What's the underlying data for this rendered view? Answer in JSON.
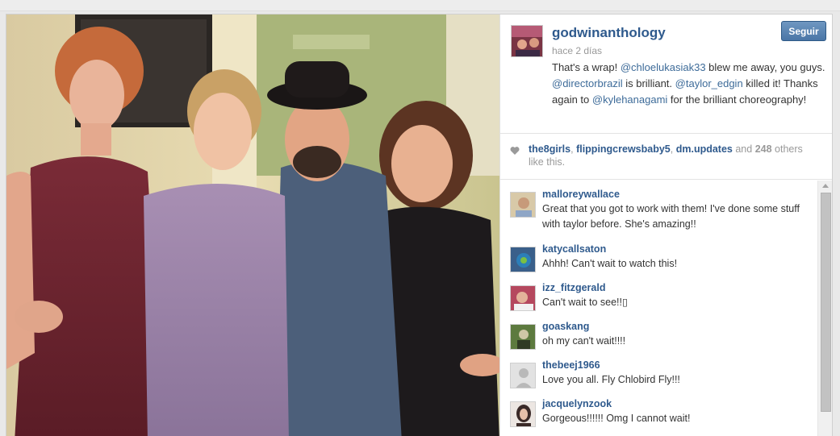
{
  "post": {
    "owner": "godwinanthology",
    "time": "hace 2 días",
    "follow_label": "Seguir",
    "caption": {
      "p1": "That's a wrap! ",
      "m1": "@chloelukasiak33",
      "p2": " blew me away, you guys. ",
      "m2": "@directorbrazil",
      "p3": " is brilliant. ",
      "m3": "@taylor_edgin",
      "p4": " killed it! Thanks again to ",
      "m4": "@kylehanagami",
      "p5": " for the brilliant choreography!"
    }
  },
  "likes": {
    "users": [
      "the8girls",
      "flippingcrewsbaby5",
      "dm.updates"
    ],
    "sep": ", ",
    "and": " and ",
    "count": "248",
    "suffix": " others like this."
  },
  "comments": [
    {
      "user": "malloreywallace",
      "text": "Great that you got to work with them! I've done some stuff with taylor before. She's amazing!!",
      "avatar_color": "#d8c9a8"
    },
    {
      "user": "katycallsaton",
      "text": "Ahhh! Can't wait to watch this!",
      "avatar_color": "#3a5f8a"
    },
    {
      "user": "izz_fitzgerald",
      "text": "Can't wait to see!!▯",
      "avatar_color": "#b5485e"
    },
    {
      "user": "goaskang",
      "text": "oh my can't wait!!!!",
      "avatar_color": "#5d7a3f"
    },
    {
      "user": "thebeej1966",
      "text": "Love you all. Fly Chlobird Fly!!!",
      "avatar_color": "#d9d9d9"
    },
    {
      "user": "jacquelynzook",
      "text": "Gorgeous!!!!!! Omg I cannot wait!",
      "avatar_color": "#3a2a28"
    }
  ],
  "icons": {
    "heart": "heart-icon",
    "scroll": "scroll-up-icon"
  },
  "colors": {
    "link": "#2f5a8d",
    "follow_button": "#4a76a6"
  }
}
